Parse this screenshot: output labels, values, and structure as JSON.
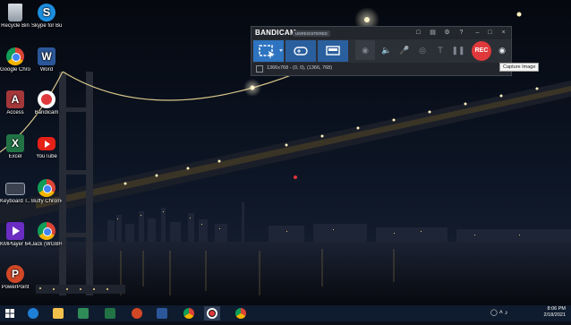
{
  "desktop": {
    "icons": [
      {
        "label": "Recycle Bin",
        "icon": "recycle-bin-icon"
      },
      {
        "label": "Skype for Business",
        "icon": "skype-icon"
      },
      {
        "label": "Google Chrome",
        "icon": "chrome-icon"
      },
      {
        "label": "Word",
        "icon": "word-icon"
      },
      {
        "label": "Access",
        "icon": "access-icon"
      },
      {
        "label": "Bandicam",
        "icon": "bandicam-icon"
      },
      {
        "label": "Excel",
        "icon": "excel-icon"
      },
      {
        "label": "YouTube",
        "icon": "youtube-icon"
      },
      {
        "label": "Keyboard T...",
        "icon": "keyboard-icon"
      },
      {
        "label": "Buffy Chrome",
        "icon": "chrome-profile-icon"
      },
      {
        "label": "KMPlayer 64X",
        "icon": "kmplayer-icon"
      },
      {
        "label": "Jack (WGBH Red F...)",
        "icon": "chrome-profile-icon"
      },
      {
        "label": "PowerPoint",
        "icon": "powerpoint-icon"
      }
    ]
  },
  "bandicam": {
    "logo": "BANDICAM",
    "badge": "UNREGISTERED",
    "rec_label": "REC",
    "status_text": "1366x768 - (0, 0), (1366, 768)",
    "tooltip": "Capture Image"
  },
  "taskbar": {
    "time": "8:06 PM",
    "date": "2/18/2021"
  },
  "colors": {
    "accent": "#2e74c0",
    "rec": "#e0393b",
    "taskbar": "#0f1b2e"
  }
}
